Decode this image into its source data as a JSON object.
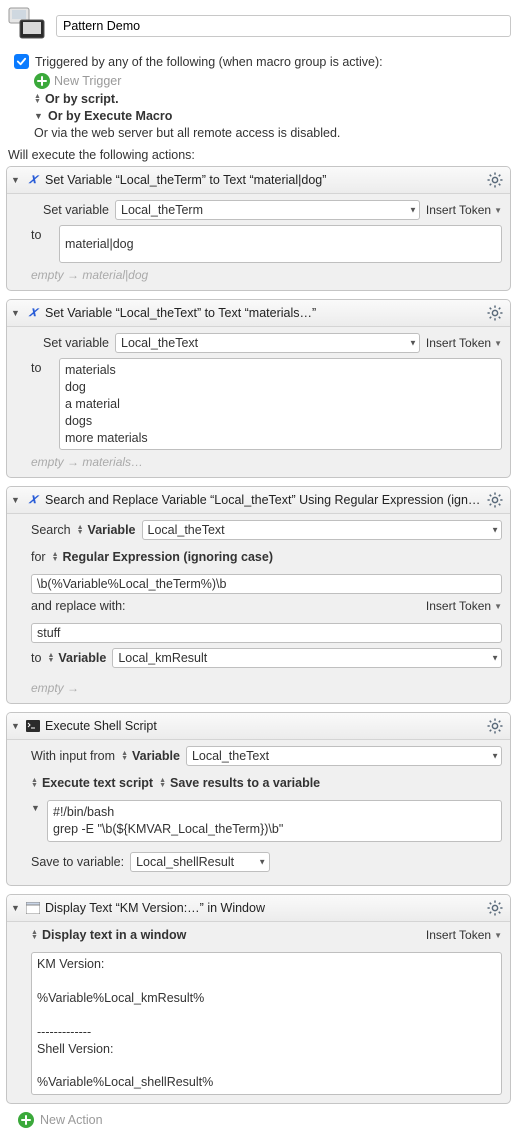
{
  "header": {
    "title": "Pattern Demo"
  },
  "trigger": {
    "label": "Triggered by any of the following (when macro group is active):",
    "new_trigger": "New Trigger",
    "or_script": "Or by script.",
    "or_execute_macro": "Or by Execute Macro",
    "or_webserver": "Or via the web server but all remote access is disabled."
  },
  "exec_label": "Will execute the following actions:",
  "insert_token": "Insert Token",
  "actions": {
    "a1": {
      "title": "Set Variable “Local_theTerm” to Text “material|dog”",
      "set_variable_label": "Set variable",
      "var": "Local_theTerm",
      "to_label": "to",
      "value": "material|dog",
      "hint_empty": "empty",
      "hint_result": "material|dog"
    },
    "a2": {
      "title": "Set Variable “Local_theText” to Text “materials…”",
      "set_variable_label": "Set variable",
      "var": "Local_theText",
      "to_label": "to",
      "value": "materials\ndog\na material\ndogs\nmore materials",
      "hint_empty": "empty",
      "hint_result": "materials…"
    },
    "a3": {
      "title": "Search and Replace Variable “Local_theText” Using Regular Expression (ignori…",
      "search_label": "Search",
      "variable_label": "Variable",
      "search_var": "Local_theText",
      "for_label": "for",
      "regex_mode": "Regular Expression (ignoring case)",
      "pattern": "\\b(%Variable%Local_theTerm%)\\b",
      "replace_label": "and replace with:",
      "replace_value": "stuff",
      "to_label": "to",
      "dest_mode": "Variable",
      "dest_var": "Local_kmResult",
      "hint_empty": "empty"
    },
    "a4": {
      "title": "Execute Shell Script",
      "with_input_label": "With input from",
      "input_mode": "Variable",
      "input_var": "Local_theText",
      "exec_mode": "Execute text script",
      "save_mode": "Save results to a variable",
      "script": "#!/bin/bash\ngrep -E \"\\b(${KMVAR_Local_theTerm})\\b\"",
      "save_to_label": "Save to variable:",
      "save_var": "Local_shellResult"
    },
    "a5": {
      "title": "Display Text “KM Version:…” in Window",
      "mode": "Display text in a window",
      "value": "KM Version:\n\n%Variable%Local_kmResult%\n\n-------------\nShell Version:\n\n%Variable%Local_shellResult%"
    }
  },
  "footer": {
    "new_action": "New Action"
  }
}
